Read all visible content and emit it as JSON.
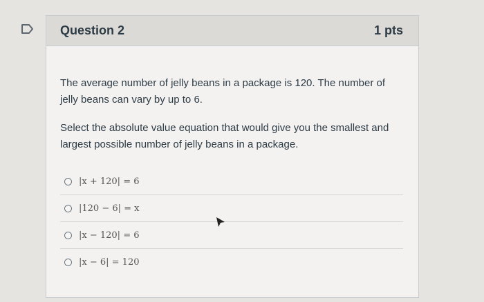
{
  "question": {
    "title": "Question 2",
    "points": "1 pts",
    "paragraphs": [
      "The average number of jelly beans in a package is 120. The number of jelly beans can vary by up to 6.",
      "Select the absolute value equation that would give you the smallest and largest possible number of jelly beans in a package."
    ],
    "options": [
      "|x + 120| = 6",
      "|120 − 6| = x",
      "|x − 120| = 6",
      "|x − 6| = 120"
    ]
  },
  "icons": {
    "flag": "flag-icon",
    "radio": "radio-icon",
    "cursor": "mouse-cursor-icon"
  },
  "colors": {
    "header_bg": "#dcdad7",
    "card_bg": "#f3f2f0",
    "text": "#2d3b45"
  }
}
